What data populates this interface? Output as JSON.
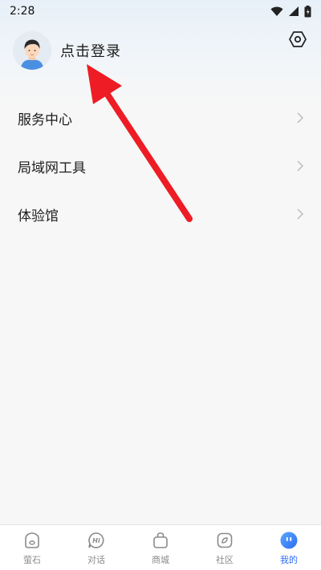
{
  "status_bar": {
    "time": "2:28"
  },
  "profile": {
    "login_label": "点击登录"
  },
  "menu": {
    "items": [
      {
        "label": "服务中心"
      },
      {
        "label": "局域网工具"
      },
      {
        "label": "体验馆"
      }
    ]
  },
  "tabbar": {
    "tabs": [
      {
        "label": "萤石",
        "icon": "home-cube-icon"
      },
      {
        "label": "对话",
        "icon": "chat-hi-icon"
      },
      {
        "label": "商城",
        "icon": "shopping-bag-icon"
      },
      {
        "label": "社区",
        "icon": "community-icon"
      },
      {
        "label": "我的",
        "icon": "profile-face-icon",
        "active": true
      }
    ]
  },
  "colors": {
    "accent": "#2d6bf3",
    "annotation_arrow": "#ee1c24"
  }
}
